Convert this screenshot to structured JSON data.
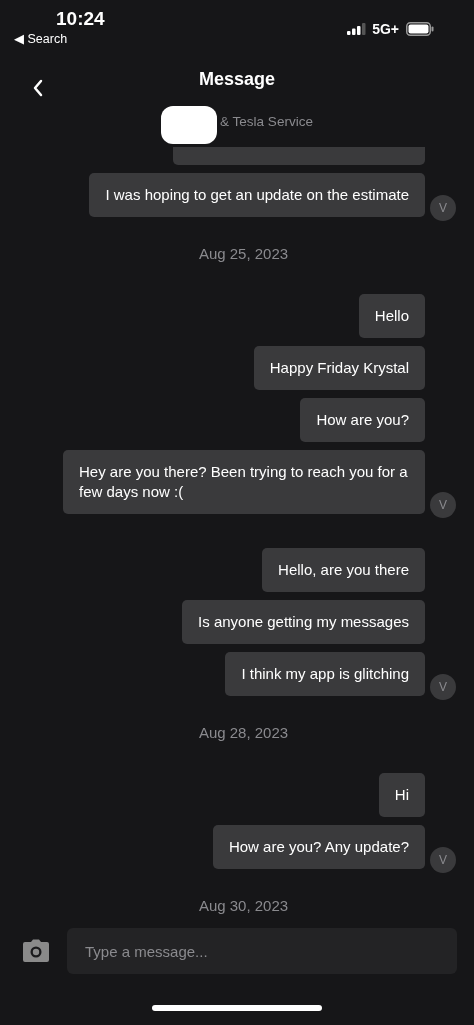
{
  "status_bar": {
    "time": "10:24",
    "back_link": "◀ Search",
    "network": "5G+"
  },
  "header": {
    "title": "Message",
    "subtitle": "& Tesla Service"
  },
  "messages": [
    {
      "kind": "clipped"
    },
    {
      "kind": "message",
      "text": "I was hoping to get an update on the estimate",
      "avatar": "V"
    },
    {
      "kind": "date",
      "text": "Aug 25, 2023"
    },
    {
      "kind": "message",
      "text": "Hello"
    },
    {
      "kind": "message",
      "text": "Happy Friday Krystal"
    },
    {
      "kind": "message",
      "text": "How are you?"
    },
    {
      "kind": "message",
      "text": "Hey are you there? Been trying to reach you for a few days now :(",
      "avatar": "V"
    },
    {
      "kind": "message",
      "text": "Hello, are you there"
    },
    {
      "kind": "message",
      "text": "Is anyone getting my messages"
    },
    {
      "kind": "message",
      "text": "I think my app is glitching",
      "avatar": "V"
    },
    {
      "kind": "date",
      "text": "Aug 28, 2023"
    },
    {
      "kind": "message",
      "text": "Hi"
    },
    {
      "kind": "message",
      "text": "How are you? Any update?",
      "avatar": "V"
    },
    {
      "kind": "date",
      "text": "Aug 30, 2023"
    }
  ],
  "composer": {
    "placeholder": "Type a message..."
  }
}
